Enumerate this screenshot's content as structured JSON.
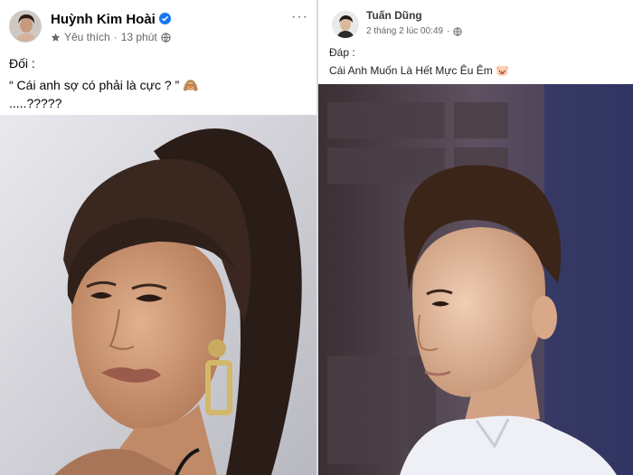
{
  "left_post": {
    "author": "Huỳnh Kim Hoài",
    "verified_icon": "verified-badge-icon",
    "meta": {
      "favorite": "Yêu thích",
      "separator": "·",
      "time": "13 phút",
      "privacy_icon": "globe-icon"
    },
    "more_label": "···",
    "lines": [
      "Đối :",
      "“ Cái anh sợ có phải là cực ? ” 🙈",
      ".....?????"
    ],
    "photo": "portrait-woman-photo"
  },
  "right_post": {
    "author": "Tuấn Dũng",
    "meta": {
      "time": "2 tháng 2 lúc 00:49",
      "separator": "·",
      "privacy_icon": "globe-icon"
    },
    "lines": [
      "Đáp :",
      "Cái Anh Muốn Là Hết Mực Êu Êm 🐷"
    ],
    "photo": "portrait-man-photo"
  },
  "colors": {
    "accent": "#1877f2",
    "text": "#050505",
    "muted": "#65676b"
  }
}
